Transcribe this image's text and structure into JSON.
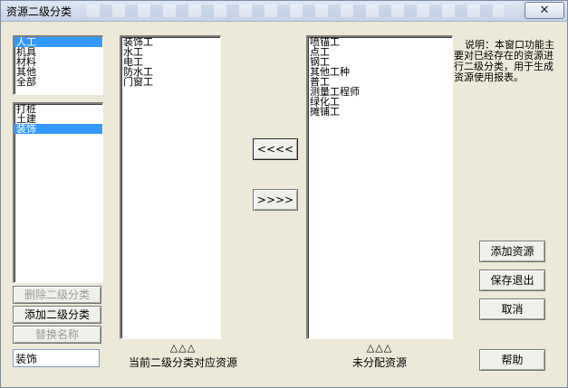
{
  "window": {
    "title": "资源二级分类",
    "close_glyph": "✕"
  },
  "category_list": {
    "items": [
      "人工",
      "机具",
      "材料",
      "其他",
      "全部"
    ],
    "selected_index": 0
  },
  "subcategory_list": {
    "items": [
      "打桩",
      "土建",
      "装饰"
    ],
    "selected_index": 2
  },
  "buttons": {
    "delete_subcategory": "删除二级分类",
    "add_subcategory": "添加二级分类",
    "rename": "替换名称",
    "move_left": "<<<<",
    "move_right": ">>>>",
    "add_resource": "添加资源",
    "save_exit": "保存退出",
    "cancel": "取消",
    "help": "帮助"
  },
  "name_input": {
    "value": "装饰"
  },
  "current_resources": {
    "items": [
      "装饰工",
      "水工",
      "电工",
      "防水工",
      "门窗工"
    ],
    "sort_marker": "△△△",
    "caption": "当前二级分类对应资源"
  },
  "unassigned_resources": {
    "items": [
      "喷锚工",
      "点工",
      "钢工",
      "其他工种",
      "普工",
      "测量工程师",
      "绿化工",
      "摊铺工"
    ],
    "sort_marker": "△△△",
    "caption": "未分配资源"
  },
  "description": {
    "text": "说明：本窗口功能主要对已经存在的资源进行二级分类，用于生成资源使用报表。"
  },
  "colors": {
    "selection": "#3399ff",
    "dialog_bg": "#ece9d8"
  }
}
